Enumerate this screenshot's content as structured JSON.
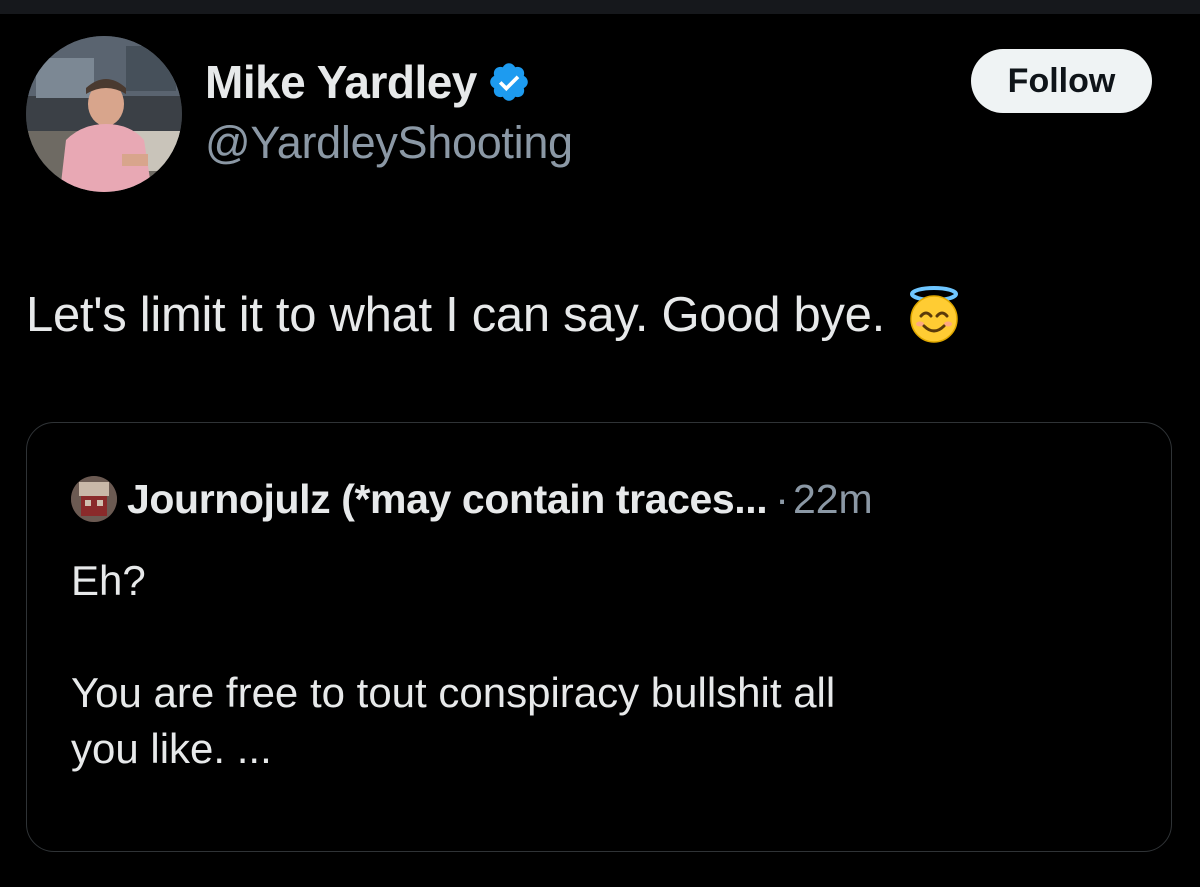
{
  "tweet": {
    "author": {
      "name": "Mike Yardley",
      "handle": "@YardleyShooting",
      "verified": true,
      "avatar_icon": "profile-photo"
    },
    "follow_label": "Follow",
    "text": "Let's limit it to what I can say. Good bye.",
    "emoji": "smiling-face-with-halo-icon",
    "quoted": {
      "author_name": "Journojulz (*may contain traces...",
      "separator": "·",
      "time": "22m",
      "body": {
        "line1": "Eh?",
        "line2": "You are free to tout conspiracy bullshit all",
        "line3": "you like. ..."
      }
    }
  },
  "colors": {
    "background": "#000000",
    "primary_text": "#e7e9ea",
    "secondary_text": "#8b98a5",
    "verified_blue": "#1d9bf0",
    "follow_bg": "#eff3f4",
    "border": "#2f3336"
  }
}
